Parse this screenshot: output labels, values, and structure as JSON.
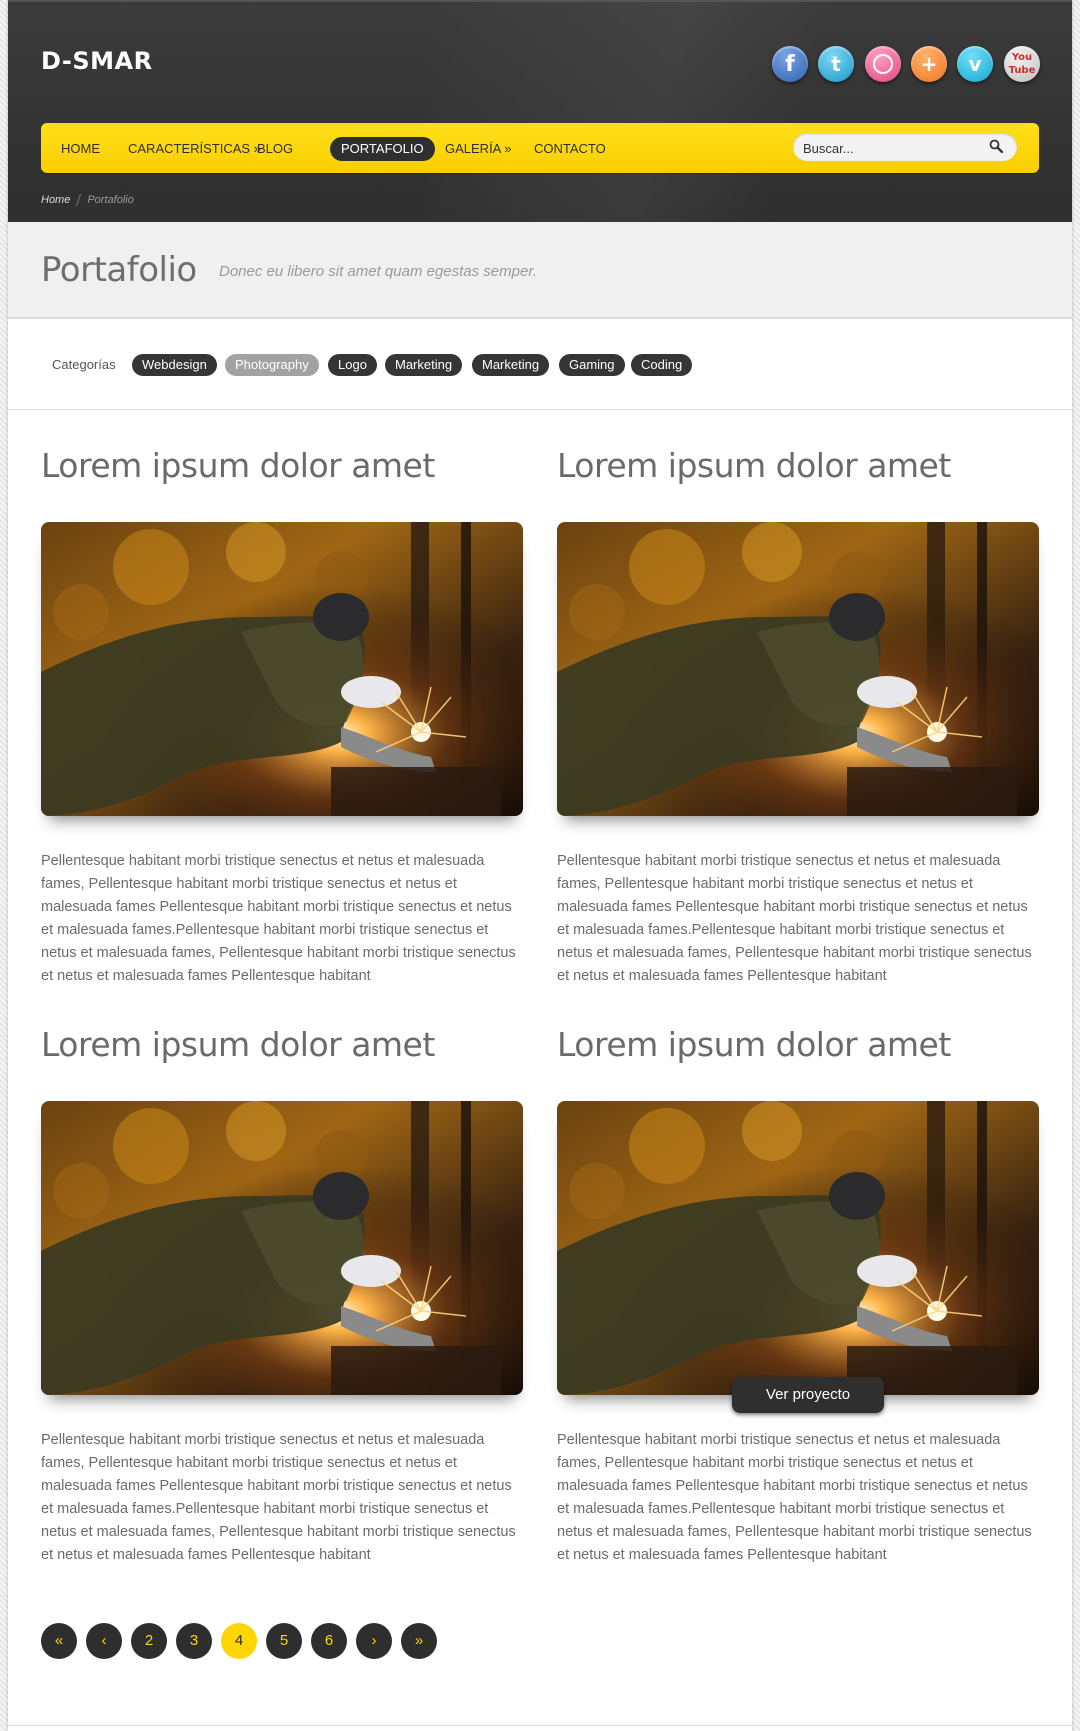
{
  "brand": {
    "logo": "D-SMAR"
  },
  "social": [
    {
      "name": "facebook",
      "glyph": "f"
    },
    {
      "name": "twitter",
      "glyph": "t"
    },
    {
      "name": "dribbble",
      "glyph": ""
    },
    {
      "name": "google-plus",
      "glyph": "+"
    },
    {
      "name": "vimeo",
      "glyph": "v"
    },
    {
      "name": "youtube",
      "glyph": "You Tube"
    }
  ],
  "nav": {
    "items": [
      {
        "label": "HOME",
        "active": false
      },
      {
        "label": "CARACTERÍSTICAS »",
        "active": false
      },
      {
        "label": "BLOG",
        "active": false
      },
      {
        "label": "PORTAFOLIO",
        "active": true
      },
      {
        "label": "GALERÍA »",
        "active": false
      },
      {
        "label": "CONTACTO",
        "active": false
      }
    ],
    "search_placeholder": "Buscar..."
  },
  "breadcrumb": {
    "home": "Home",
    "current": "Portafolio"
  },
  "page": {
    "title": "Portafolio",
    "subtitle": "Donec eu libero sit amet quam egestas semper."
  },
  "categories": {
    "label": "Categorías",
    "items": [
      {
        "label": "Webdesign",
        "selected": false
      },
      {
        "label": "Photography",
        "selected": true
      },
      {
        "label": "Logo",
        "selected": false
      },
      {
        "label": "Marketing",
        "selected": false
      },
      {
        "label": "Marketing",
        "selected": false
      },
      {
        "label": "Gaming",
        "selected": false
      },
      {
        "label": "Coding",
        "selected": false
      }
    ]
  },
  "projects": [
    {
      "title": "Lorem ipsum dolor amet",
      "text": "Pellentesque habitant morbi tristique senectus et netus et malesuada fames, Pellentesque habitant morbi tristique senectus et netus et malesuada fames Pellentesque habitant morbi tristique senectus et netus et malesuada fames.Pellentesque habitant morbi tristique senectus et netus et malesuada fames, Pellentesque habitant morbi tristique senectus et netus et malesuada fames Pellentesque habitant"
    },
    {
      "title": "Lorem ipsum dolor amet",
      "text": "Pellentesque habitant morbi tristique senectus et netus et malesuada fames, Pellentesque habitant morbi tristique senectus et netus et malesuada fames Pellentesque habitant morbi tristique senectus et netus et malesuada fames.Pellentesque habitant morbi tristique senectus et netus et malesuada fames, Pellentesque habitant morbi tristique senectus et netus et malesuada fames Pellentesque habitant"
    },
    {
      "title": "Lorem ipsum dolor amet",
      "text": "Pellentesque habitant morbi tristique senectus et netus et malesuada fames, Pellentesque habitant morbi tristique senectus et netus et malesuada fames Pellentesque habitant morbi tristique senectus et netus et malesuada fames.Pellentesque habitant morbi tristique senectus et netus et malesuada fames, Pellentesque habitant morbi tristique senectus et netus et malesuada fames Pellentesque habitant"
    },
    {
      "title": "Lorem ipsum dolor amet",
      "text": "Pellentesque habitant morbi tristique senectus et netus et malesuada fames, Pellentesque habitant morbi tristique senectus et netus et malesuada fames Pellentesque habitant morbi tristique senectus et netus et malesuada fames.Pellentesque habitant morbi tristique senectus et netus et malesuada fames, Pellentesque habitant morbi tristique senectus et netus et malesuada fames Pellentesque habitant",
      "hover_button": "Ver proyecto"
    }
  ],
  "pagination": {
    "items": [
      {
        "label": "«",
        "current": false
      },
      {
        "label": "‹",
        "current": false
      },
      {
        "label": "2",
        "current": false
      },
      {
        "label": "3",
        "current": false
      },
      {
        "label": "4",
        "current": true
      },
      {
        "label": "5",
        "current": false
      },
      {
        "label": "6",
        "current": false
      },
      {
        "label": "›",
        "current": false
      },
      {
        "label": "»",
        "current": false
      }
    ]
  },
  "colors": {
    "accent": "#ffd600",
    "dark": "#2f2f2f",
    "header": "#353536"
  }
}
